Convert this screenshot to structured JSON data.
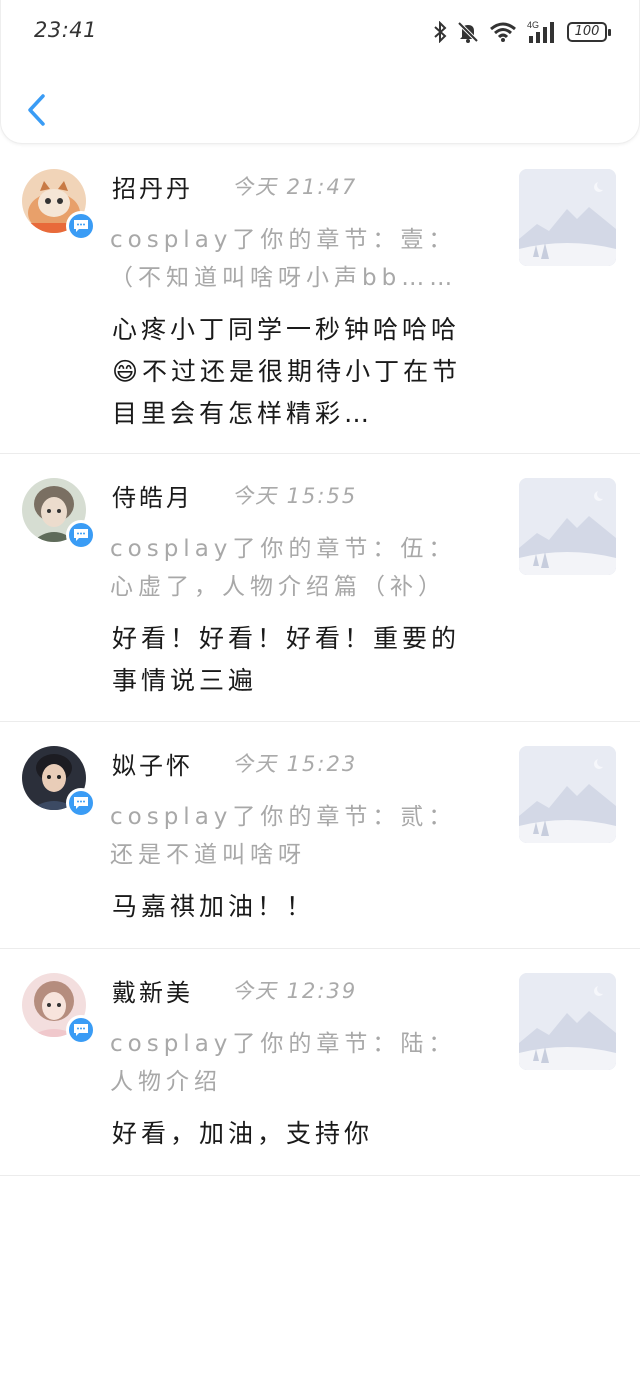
{
  "status_bar": {
    "time": "23:41",
    "battery": "100",
    "network": "4G",
    "icons": [
      "bluetooth-icon",
      "mute-bell-icon",
      "wifi-icon",
      "signal-icon",
      "battery-icon"
    ]
  },
  "header": {
    "back_icon": "chevron-left-icon"
  },
  "colors": {
    "accent": "#3a9cf5",
    "secondary_text": "#a8a8a8",
    "divider": "#ececec"
  },
  "comments": [
    {
      "user": "招丹丹",
      "time": "今天 21:47",
      "chapter": "cosplay了你的章节：壹：（不知道叫啥呀小声bb……",
      "text": "心疼小丁同学一秒钟哈哈哈😄不过还是很期待小丁在节目里会有怎样精彩…"
    },
    {
      "user": "侍皓月",
      "time": "今天 15:55",
      "chapter": "cosplay了你的章节：伍：心虚了，人物介绍篇（补）",
      "text": "好看！好看！好看！重要的事情说三遍"
    },
    {
      "user": "姒子怀",
      "time": "今天 15:23",
      "chapter": "cosplay了你的章节：贰：还是不道叫啥呀",
      "text": "马嘉祺加油！！"
    },
    {
      "user": "戴新美",
      "time": "今天 12:39",
      "chapter": "cosplay了你的章节：陆：人物介绍",
      "text": "好看，加油，支持你"
    }
  ]
}
